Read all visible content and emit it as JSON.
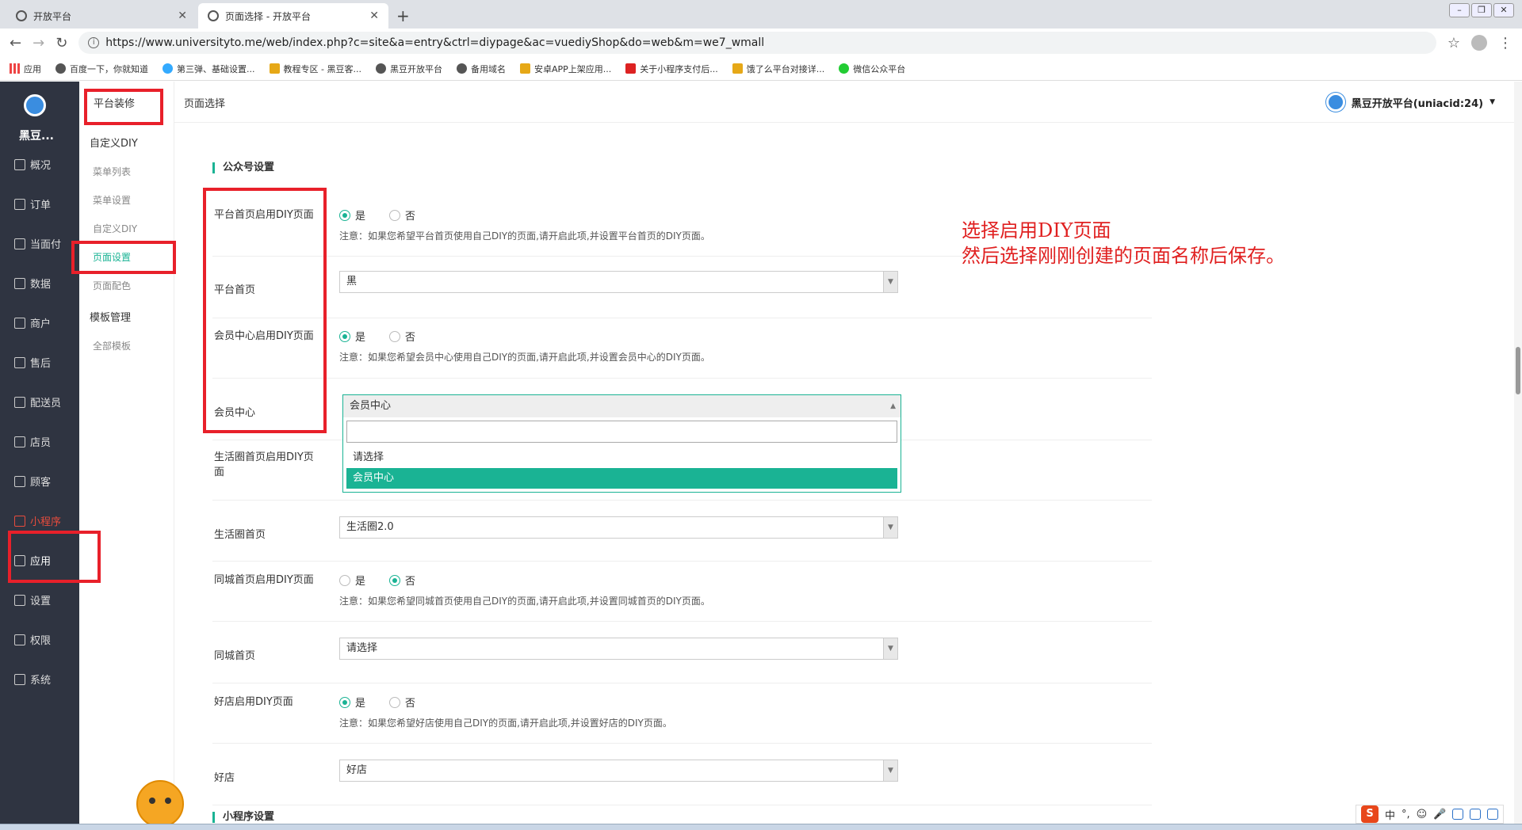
{
  "browser": {
    "tabs": [
      {
        "title": "开放平台",
        "active": false
      },
      {
        "title": "页面选择 - 开放平台",
        "active": true
      }
    ],
    "url": "https://www.universityto.me/web/index.php?c=site&a=entry&ctrl=diypage&ac=vuediyShop&do=web&m=we7_wmall",
    "bookmarks": [
      {
        "label": "应用",
        "icon": "apps-grid-icon"
      },
      {
        "label": "百度一下，你就知道",
        "icon": "globe-icon"
      },
      {
        "label": "第三弹、基础设置...",
        "icon": "cloud-icon"
      },
      {
        "label": "教程专区 - 黑豆客...",
        "icon": "trophy-icon"
      },
      {
        "label": "黑豆开放平台",
        "icon": "globe-icon"
      },
      {
        "label": "备用域名",
        "icon": "globe-icon"
      },
      {
        "label": "安卓APP上架应用...",
        "icon": "trophy-icon"
      },
      {
        "label": "关于小程序支付后...",
        "icon": "c-logo-icon"
      },
      {
        "label": "饿了么平台对接详...",
        "icon": "trophy-icon"
      },
      {
        "label": "微信公众平台",
        "icon": "wechat-icon"
      }
    ]
  },
  "sidebar": {
    "brand": "黑豆...",
    "items": [
      {
        "label": "概况",
        "icon": "overview-icon"
      },
      {
        "label": "订单",
        "icon": "order-icon"
      },
      {
        "label": "当面付",
        "icon": "pay-icon"
      },
      {
        "label": "数据",
        "icon": "chart-icon"
      },
      {
        "label": "商户",
        "icon": "store-icon"
      },
      {
        "label": "售后",
        "icon": "service-icon"
      },
      {
        "label": "配送员",
        "icon": "courier-icon"
      },
      {
        "label": "店员",
        "icon": "clerk-icon"
      },
      {
        "label": "顾客",
        "icon": "customer-icon"
      },
      {
        "label": "小程序",
        "icon": "miniprogram-icon"
      },
      {
        "label": "应用",
        "icon": "app-icon"
      },
      {
        "label": "设置",
        "icon": "gear-icon"
      },
      {
        "label": "权限",
        "icon": "lock-icon"
      },
      {
        "label": "系统",
        "icon": "system-icon"
      }
    ]
  },
  "subnav": {
    "items": [
      {
        "label": "平台装修",
        "level": 1
      },
      {
        "label": "自定义DIY",
        "level": 1
      },
      {
        "label": "菜单列表",
        "level": 2
      },
      {
        "label": "菜单设置",
        "level": 2
      },
      {
        "label": "自定义DIY",
        "level": 2
      },
      {
        "label": "页面设置",
        "level": 2,
        "active": true
      },
      {
        "label": "页面配色",
        "level": 2
      },
      {
        "label": "模板管理",
        "level": 1
      },
      {
        "label": "全部模板",
        "level": 2
      }
    ]
  },
  "header": {
    "page_title": "页面选择",
    "account": "黑豆开放平台(uniacid:24)"
  },
  "form": {
    "section1": "公众号设置",
    "section2": "小程序设置",
    "yes": "是",
    "no": "否",
    "rows": {
      "platform_enable": {
        "label": "平台首页启用DIY页面",
        "note": "注意：如果您希望平台首页使用自己DIY的页面,请开启此项,并设置平台首页的DIY页面。"
      },
      "platform_home": {
        "label": "平台首页",
        "value": "黑"
      },
      "member_enable": {
        "label": "会员中心启用DIY页面",
        "note": "注意：如果您希望会员中心使用自己DIY的页面,请开启此项,并设置会员中心的DIY页面。"
      },
      "member_center": {
        "label": "会员中心",
        "value": "会员中心",
        "options": [
          "请选择",
          "会员中心"
        ]
      },
      "life_enable": {
        "label": "生活圈首页启用DIY页面"
      },
      "life_home": {
        "label": "生活圈首页",
        "value": "生活圈2.0"
      },
      "city_enable": {
        "label": "同城首页启用DIY页面",
        "note": "注意：如果您希望同城首页使用自己DIY的页面,请开启此项,并设置同城首页的DIY页面。"
      },
      "city_home": {
        "label": "同城首页",
        "value": "请选择"
      },
      "shop_enable": {
        "label": "好店启用DIY页面",
        "note": "注意：如果您希望好店使用自己DIY的页面,请开启此项,并设置好店的DIY页面。"
      },
      "shop_home": {
        "label": "好店",
        "value": "好店"
      }
    }
  },
  "annotation": {
    "line1": "选择启用DIY页面",
    "line2": "然后选择刚刚创建的页面名称后保存。"
  },
  "ime": {
    "mode": "中"
  },
  "colors": {
    "accent": "#1ab394",
    "sidebar": "#2f3441",
    "annotation": "#e02020"
  }
}
